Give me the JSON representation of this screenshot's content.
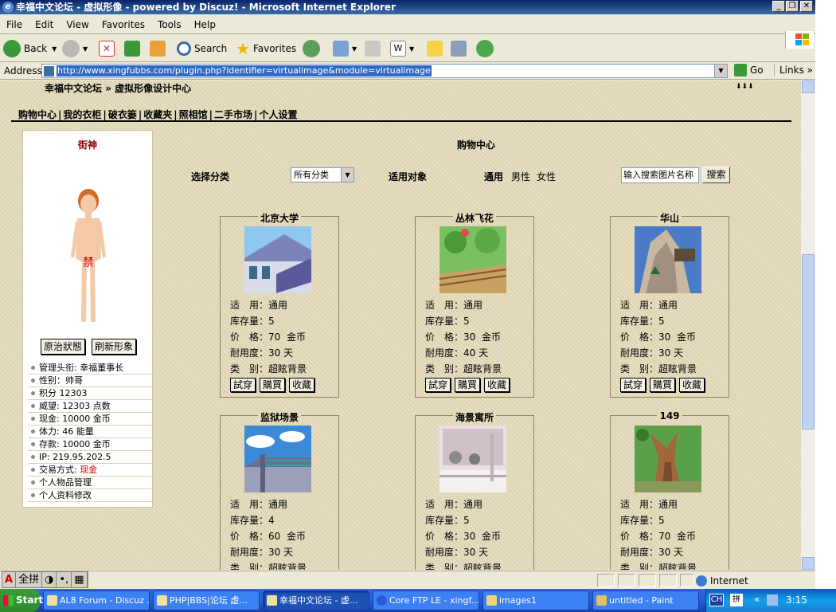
{
  "window": {
    "title": "幸福中文论坛 - 虚拟形像 - powered by Discuz! - Microsoft Internet Explorer"
  },
  "menu": [
    "File",
    "Edit",
    "View",
    "Favorites",
    "Tools",
    "Help"
  ],
  "toolbar": {
    "back": "Back",
    "search": "Search",
    "favorites": "Favorites"
  },
  "address": {
    "label": "Address",
    "url": "http://www.xingfubbs.com/plugin.php?identifier=virtualimage&module=virtualimage",
    "go": "Go",
    "links": "Links"
  },
  "page": {
    "breadcrumb": "幸福中文论坛 » 虚拟形像设计中心",
    "corner": "⬇⬇⬇",
    "nav": [
      "购物中心",
      "我的衣柜",
      "破衣篓",
      "收藏夹",
      "照相馆",
      "二手市场",
      "个人设置"
    ],
    "nav_sep": "|",
    "user": {
      "name": "街神",
      "buttons": [
        "原治狀態",
        "刷新形象"
      ],
      "stats": [
        {
          "label": "管理头衔: 幸福董事长"
        },
        {
          "label": "性别：帅哥"
        },
        {
          "label": "积分 12303"
        },
        {
          "label": "威望: 12303 点数"
        },
        {
          "label": "现金: 10000 金币"
        },
        {
          "label": "体力: 46 能量"
        },
        {
          "label": "存款: 10000 金币"
        },
        {
          "label": "IP: 219.95.202.5"
        },
        {
          "label": "交易方式: ",
          "highlight": "现金"
        },
        {
          "label": "个人物品管理"
        },
        {
          "label": "个人资料修改"
        }
      ]
    },
    "shop_title": "购物中心",
    "filter": {
      "category_label": "选择分类",
      "category_value": "所有分类",
      "target_label": "适用对象",
      "targets": [
        "通用",
        "男性",
        "女性"
      ],
      "search_placeholder": "输入搜索图片名称",
      "search_button": "搜索"
    },
    "item_labels": {
      "usage": "适　用：",
      "stock": "库存量：",
      "price": "价　格：",
      "durability": "耐用度：",
      "type": "类　别：",
      "currency": "金币",
      "days": "天"
    },
    "item_buttons": [
      "試穿",
      "購買",
      "收藏"
    ],
    "items": [
      {
        "name": "北京大学",
        "usage": "通用",
        "stock": "5",
        "price": "70",
        "durability": "30",
        "type": "超眩背景"
      },
      {
        "name": "丛林飞花",
        "usage": "通用",
        "stock": "5",
        "price": "30",
        "durability": "40",
        "type": "超眩背景"
      },
      {
        "name": "华山",
        "usage": "通用",
        "stock": "5",
        "price": "30",
        "durability": "30",
        "type": "超眩背景"
      },
      {
        "name": "监狱场景",
        "usage": "通用",
        "stock": "4",
        "price": "60",
        "durability": "30",
        "type": "超眩背景"
      },
      {
        "name": "海景寓所",
        "usage": "通用",
        "stock": "5",
        "price": "30",
        "durability": "30",
        "type": "超眩背景"
      },
      {
        "name": "149",
        "usage": "通用",
        "stock": "5",
        "price": "70",
        "durability": "30",
        "type": "超眩背景"
      }
    ]
  },
  "status": {
    "zone": "Internet",
    "ime": [
      "A",
      "全拼",
      "◑",
      "•,",
      "▦"
    ]
  },
  "taskbar": {
    "start": "Start",
    "tasks": [
      "AL8 Forum - Discuz ...",
      "PHP|BBS|论坛 虚...",
      "幸福中文论坛 - 虚...",
      "Core FTP LE - xingf...",
      "images1",
      "untitled - Paint"
    ],
    "lang": "CH",
    "time": "3:15"
  }
}
